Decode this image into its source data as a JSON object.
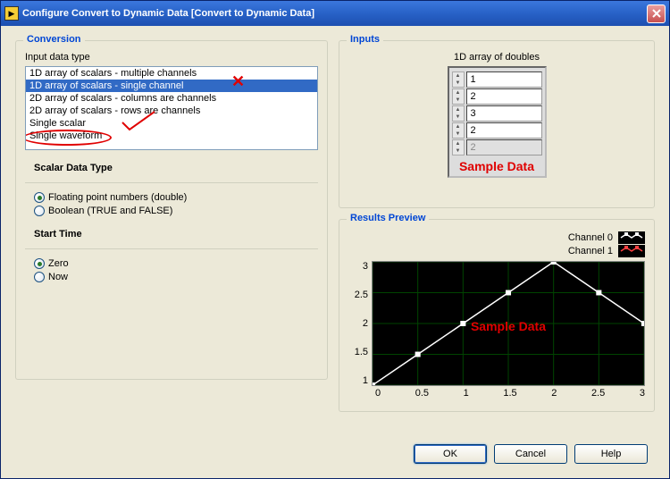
{
  "window": {
    "title": "Configure Convert to Dynamic Data [Convert to Dynamic Data]"
  },
  "conversion": {
    "title": "Conversion",
    "input_type_label": "Input data type",
    "list_items": [
      "1D array of scalars - multiple channels",
      "1D array of scalars - single channel",
      "2D array of scalars - columns are channels",
      "2D array of scalars - rows are channels",
      "Single scalar",
      "Single waveform"
    ],
    "selected_index": 1,
    "scalar_type": {
      "title": "Scalar Data Type",
      "float_label": "Floating point numbers (double)",
      "bool_label": "Boolean (TRUE and FALSE)",
      "selected": "float"
    },
    "start_time": {
      "title": "Start Time",
      "zero_label": "Zero",
      "now_label": "Now",
      "selected": "zero"
    }
  },
  "inputs": {
    "title": "Inputs",
    "array_label": "1D array of doubles",
    "values": [
      "1",
      "2",
      "3",
      "2",
      "2"
    ],
    "dimmed_index": 4,
    "sample_text": "Sample Data"
  },
  "results": {
    "title": "Results Preview",
    "legend": [
      {
        "name": "Channel 0",
        "color": "#ffffff"
      },
      {
        "name": "Channel 1",
        "color": "#ff4040"
      }
    ],
    "sample_text": "Sample Data"
  },
  "buttons": {
    "ok": "OK",
    "cancel": "Cancel",
    "help": "Help"
  },
  "chart_data": {
    "type": "line",
    "x": [
      0,
      0.5,
      1,
      1.5,
      2,
      2.5,
      3
    ],
    "series": [
      {
        "name": "Channel 0",
        "values": [
          1,
          1.5,
          2,
          2.5,
          3,
          2.5,
          2
        ],
        "color": "#ffffff"
      }
    ],
    "xlabel": "",
    "ylabel": "",
    "xlim": [
      0,
      3
    ],
    "ylim": [
      1,
      3
    ],
    "y_ticks": [
      "3",
      "2.5",
      "2",
      "1.5",
      "1"
    ],
    "x_ticks": [
      "0",
      "0.5",
      "1",
      "1.5",
      "2",
      "2.5",
      "3"
    ],
    "grid": true,
    "grid_color": "#004400",
    "background": "#000000"
  }
}
